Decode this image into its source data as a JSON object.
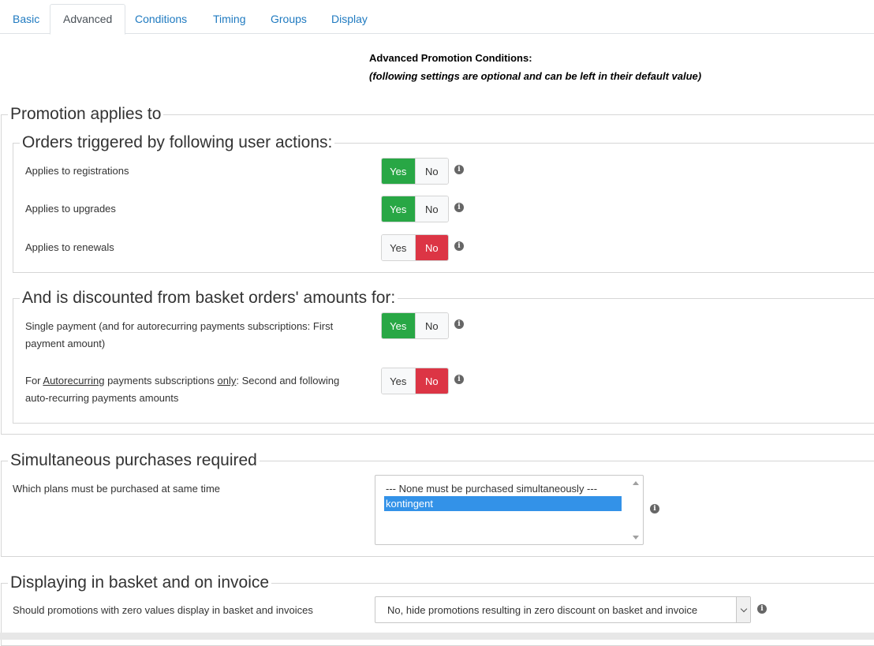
{
  "tabs": [
    {
      "label": "Basic"
    },
    {
      "label": "Advanced"
    },
    {
      "label": "Conditions"
    },
    {
      "label": "Timing"
    },
    {
      "label": "Groups"
    },
    {
      "label": "Display"
    }
  ],
  "active_tab": "Advanced",
  "header": {
    "title": "Advanced Promotion Conditions:",
    "subtitle": "(following settings are optional and can be left in their default value)"
  },
  "promotion_applies": {
    "legend": "Promotion applies to",
    "user_actions": {
      "legend": "Orders triggered by following user actions:",
      "rows": [
        {
          "label": "Applies to registrations",
          "yes": "Yes",
          "no": "No",
          "value": "yes"
        },
        {
          "label": "Applies to upgrades",
          "yes": "Yes",
          "no": "No",
          "value": "yes"
        },
        {
          "label": "Applies to renewals",
          "yes": "Yes",
          "no": "No",
          "value": "no"
        }
      ]
    },
    "discounted": {
      "legend": "And is discounted from basket orders' amounts for:",
      "rows": [
        {
          "label_line1": "Single payment (and for autorecurring payments subscriptions: First",
          "label_line2": "payment amount)",
          "yes": "Yes",
          "no": "No",
          "value": "yes"
        },
        {
          "label_prefix": "For ",
          "label_u1": "Autorecurring",
          "label_mid": " payments subscriptions ",
          "label_u2": "only",
          "label_suffix": ": Second and following",
          "label_line2": "auto-recurring payments amounts",
          "yes": "Yes",
          "no": "No",
          "value": "no"
        }
      ]
    }
  },
  "simultaneous": {
    "legend": "Simultaneous purchases required",
    "label": "Which plans must be purchased at same time",
    "options": [
      "--- None must be purchased simultaneously ---",
      "kontingent"
    ],
    "selected": "kontingent"
  },
  "display": {
    "legend": "Displaying in basket and on invoice",
    "label": "Should promotions with zero values display in basket and invoices",
    "selected": "No, hide promotions resulting in zero discount on basket and invoice"
  },
  "icons": {
    "info": "info-icon",
    "dropdown": "chevron-down-icon"
  },
  "colors": {
    "link": "#1f7ac0",
    "yes_active": "#28a745",
    "no_active": "#dc3545",
    "selected_option": "#3392e8"
  }
}
